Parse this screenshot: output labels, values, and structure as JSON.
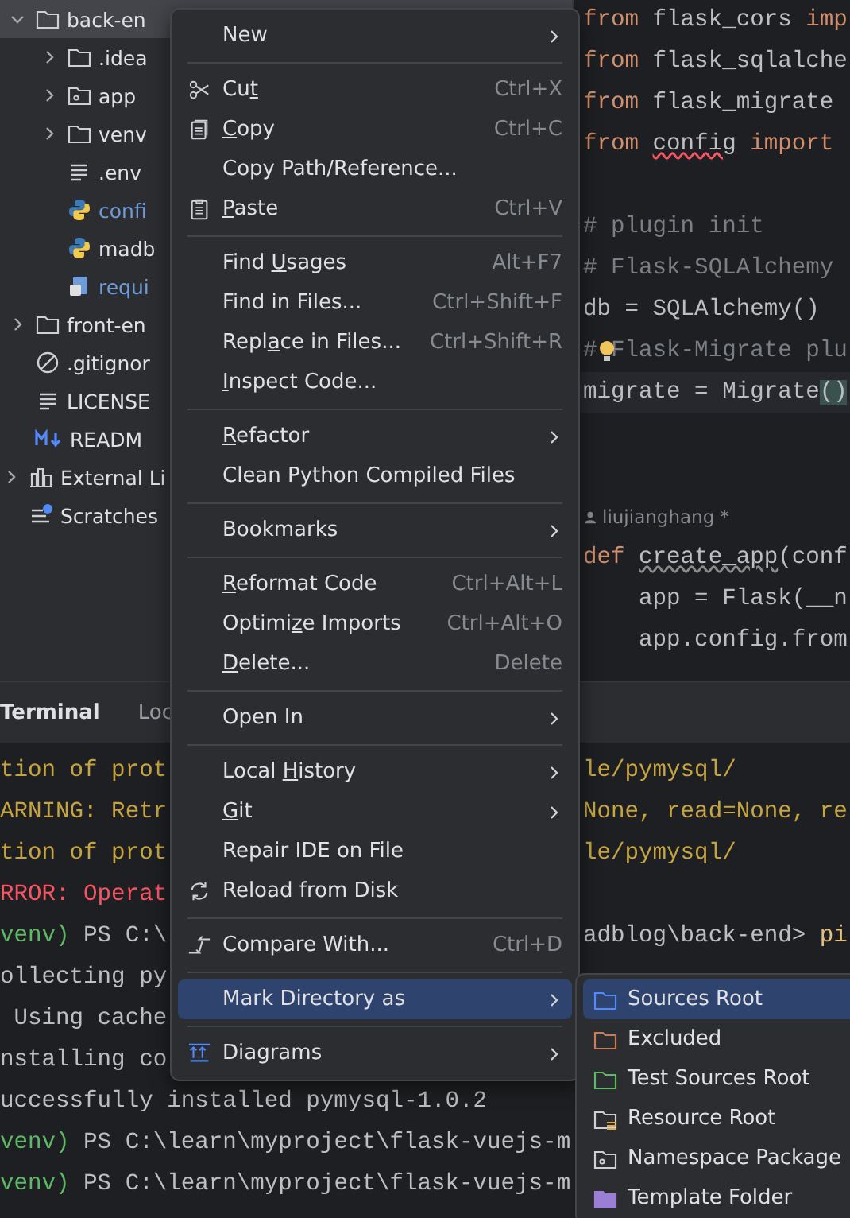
{
  "project_files": [
    {
      "label": "back-en",
      "kind": "folder",
      "expanded": true,
      "selected": true,
      "modified": false,
      "children": [
        {
          "label": ".idea",
          "kind": "folder",
          "expanded": false,
          "selected": false,
          "modified": false
        },
        {
          "label": "app",
          "kind": "package",
          "expanded": false,
          "selected": false,
          "modified": false
        },
        {
          "label": "venv",
          "kind": "folder",
          "expanded": false,
          "selected": false,
          "modified": false
        },
        {
          "label": ".env",
          "kind": "text",
          "selected": false,
          "modified": false
        },
        {
          "label": "confi",
          "kind": "python",
          "selected": false,
          "modified": true
        },
        {
          "label": "madb",
          "kind": "python",
          "selected": false,
          "modified": false
        },
        {
          "label": "requi",
          "kind": "requirements",
          "selected": false,
          "modified": true
        }
      ]
    },
    {
      "label": "front-en",
      "kind": "folder",
      "expanded": false,
      "selected": false,
      "modified": false
    },
    {
      "label": ".gitignor",
      "kind": "ignore",
      "selected": false,
      "modified": false
    },
    {
      "label": "LICENSE",
      "kind": "text",
      "selected": false,
      "modified": false
    },
    {
      "label": "READM",
      "kind": "markdown",
      "selected": false,
      "modified": false
    }
  ],
  "root_items": [
    {
      "label": "External Li",
      "kind": "library",
      "expanded": false,
      "selected": false,
      "modified": false
    },
    {
      "label": "Scratches",
      "kind": "scratches",
      "selected": false,
      "modified": false
    }
  ],
  "editor": {
    "lines": [
      {
        "kind": "code",
        "current": false,
        "bulb": false,
        "tokens": [
          {
            "text": "from",
            "kind": "kw"
          },
          {
            "text": " flask_cors ",
            "kind": "plain"
          },
          {
            "text": "imp",
            "kind": "kw"
          }
        ]
      },
      {
        "kind": "code",
        "current": false,
        "bulb": false,
        "tokens": [
          {
            "text": "from",
            "kind": "kw"
          },
          {
            "text": " flask_sqlalche",
            "kind": "plain"
          }
        ]
      },
      {
        "kind": "code",
        "current": false,
        "bulb": false,
        "tokens": [
          {
            "text": "from",
            "kind": "kw"
          },
          {
            "text": " flask_migrate",
            "kind": "plain"
          }
        ]
      },
      {
        "kind": "code",
        "current": false,
        "bulb": false,
        "tokens": [
          {
            "text": "from ",
            "kind": "kw"
          },
          {
            "text": "config",
            "kind": "error"
          },
          {
            "text": " import",
            "kind": "kw"
          }
        ]
      },
      {
        "kind": "blank"
      },
      {
        "kind": "code",
        "current": false,
        "bulb": false,
        "tokens": [
          {
            "text": "# plugin init",
            "kind": "comment"
          }
        ]
      },
      {
        "kind": "code",
        "current": false,
        "bulb": false,
        "tokens": [
          {
            "text": "# Flask-SQLAlchemy",
            "kind": "comment"
          }
        ]
      },
      {
        "kind": "code",
        "current": false,
        "bulb": false,
        "tokens": [
          {
            "text": "db = SQLAlchemy()",
            "kind": "plain"
          }
        ]
      },
      {
        "kind": "code",
        "current": false,
        "bulb": true,
        "tokens": [
          {
            "text": "# Flask-Migrate plu",
            "kind": "comment"
          }
        ]
      },
      {
        "kind": "code",
        "current": true,
        "bulb": false,
        "tokens": [
          {
            "text": "migrate = Migrate",
            "kind": "plain"
          },
          {
            "text": "()",
            "kind": "brace"
          }
        ]
      },
      {
        "kind": "blank"
      },
      {
        "kind": "blank"
      },
      {
        "kind": "author",
        "text": "liujianghang *"
      },
      {
        "kind": "code",
        "current": false,
        "bulb": false,
        "tokens": [
          {
            "text": "def ",
            "kind": "kw"
          },
          {
            "text": "create_app",
            "kind": "warn"
          },
          {
            "text": "(conf",
            "kind": "plain"
          }
        ]
      },
      {
        "kind": "code",
        "current": false,
        "bulb": false,
        "tokens": [
          {
            "text": "    app = Flask(__n",
            "kind": "plain"
          }
        ]
      },
      {
        "kind": "code",
        "current": false,
        "bulb": false,
        "tokens": [
          {
            "text": "    app.config.from",
            "kind": "plain"
          }
        ]
      }
    ]
  },
  "terminal": {
    "tabs": [
      {
        "label": "Terminal",
        "selected": true
      },
      {
        "label": "Loc",
        "selected": false
      }
    ],
    "lines": [
      {
        "left": [
          {
            "text": "tion of prot",
            "kind": "warn"
          }
        ],
        "right": [
          {
            "text": "le/pymysql/",
            "kind": "warn"
          }
        ]
      },
      {
        "left": [
          {
            "text": "ARNING: Retr",
            "kind": "warn"
          }
        ],
        "right": [
          {
            "text": "None, read=None, re",
            "kind": "warn"
          }
        ]
      },
      {
        "left": [
          {
            "text": "tion of prot",
            "kind": "warn"
          }
        ],
        "right": [
          {
            "text": "le/pymysql/",
            "kind": "warn"
          }
        ]
      },
      {
        "left": [
          {
            "text": "RROR: Operat",
            "kind": "error"
          }
        ]
      },
      {
        "left": [
          {
            "text": "venv)",
            "kind": "green"
          },
          {
            "text": " PS C:\\",
            "kind": "plain"
          }
        ],
        "right": [
          {
            "text": "adblog\\back-end> ",
            "kind": "plain"
          },
          {
            "text": "pi",
            "kind": "cmd"
          }
        ]
      },
      {
        "left": [
          {
            "text": "ollecting py",
            "kind": "plain"
          }
        ]
      },
      {
        "left": [
          {
            "text": " Using cache",
            "kind": "plain"
          }
        ]
      },
      {
        "left": [
          {
            "text": "nstalling co",
            "kind": "plain"
          }
        ]
      },
      {
        "left": [
          {
            "text": "uccessfully installed pymysql-1.0.2",
            "kind": "plain"
          }
        ]
      },
      {
        "left": [
          {
            "text": "venv)",
            "kind": "green"
          },
          {
            "text": " PS C:\\learn\\myproject\\flask-vuejs-m",
            "kind": "plain"
          }
        ]
      },
      {
        "left": [
          {
            "text": "venv)",
            "kind": "green"
          },
          {
            "text": " PS C:\\learn\\myproject\\flask-vuejs-m",
            "kind": "plain"
          }
        ]
      }
    ]
  },
  "context_menu": {
    "items": [
      {
        "kind": "text",
        "label": "New",
        "submenu": true,
        "selected": false
      },
      {
        "kind": "separator"
      },
      {
        "kind": "cut",
        "pre": "Cu",
        "key": "t",
        "shortcut": "Ctrl+X",
        "submenu": false,
        "selected": false
      },
      {
        "kind": "copy",
        "key": "C",
        "post": "opy",
        "shortcut": "Ctrl+C",
        "submenu": false,
        "selected": false
      },
      {
        "kind": "text",
        "label": "Copy Path/Reference...",
        "submenu": false,
        "selected": false
      },
      {
        "kind": "paste",
        "key": "P",
        "post": "aste",
        "shortcut": "Ctrl+V",
        "submenu": false,
        "selected": false
      },
      {
        "kind": "separator"
      },
      {
        "kind": "text",
        "pre": "Find ",
        "key": "U",
        "post": "sages",
        "shortcut": "Alt+F7",
        "submenu": false,
        "selected": false
      },
      {
        "kind": "text",
        "label": "Find in Files...",
        "shortcut": "Ctrl+Shift+F",
        "submenu": false,
        "selected": false
      },
      {
        "kind": "text",
        "pre": "Repl",
        "key": "a",
        "post": "ce in Files...",
        "shortcut": "Ctrl+Shift+R",
        "submenu": false,
        "selected": false
      },
      {
        "kind": "text",
        "key": "I",
        "post": "nspect Code...",
        "submenu": false,
        "selected": false
      },
      {
        "kind": "separator"
      },
      {
        "kind": "text",
        "key": "R",
        "post": "efactor",
        "submenu": true,
        "selected": false
      },
      {
        "kind": "text",
        "label": "Clean Python Compiled Files",
        "submenu": false,
        "selected": false
      },
      {
        "kind": "separator"
      },
      {
        "kind": "text",
        "label": "Bookmarks",
        "submenu": true,
        "selected": false
      },
      {
        "kind": "separator"
      },
      {
        "kind": "text",
        "key": "R",
        "post": "eformat Code",
        "shortcut": "Ctrl+Alt+L",
        "submenu": false,
        "selected": false
      },
      {
        "kind": "text",
        "pre": "Optimi",
        "key": "z",
        "post": "e Imports",
        "shortcut": "Ctrl+Alt+O",
        "submenu": false,
        "selected": false
      },
      {
        "kind": "text",
        "key": "D",
        "post": "elete...",
        "shortcut": "Delete",
        "submenu": false,
        "selected": false
      },
      {
        "kind": "separator"
      },
      {
        "kind": "text",
        "label": "Open In",
        "submenu": true,
        "selected": false
      },
      {
        "kind": "separator"
      },
      {
        "kind": "text",
        "pre": "Local ",
        "key": "H",
        "post": "istory",
        "submenu": true,
        "selected": false
      },
      {
        "kind": "text",
        "key": "G",
        "post": "it",
        "submenu": true,
        "selected": false
      },
      {
        "kind": "text",
        "label": "Repair IDE on File",
        "submenu": false,
        "selected": false
      },
      {
        "kind": "reload",
        "label": "Reload from Disk",
        "submenu": false,
        "selected": false
      },
      {
        "kind": "separator"
      },
      {
        "kind": "compare",
        "label": "Compare With...",
        "shortcut": "Ctrl+D",
        "submenu": false,
        "selected": false
      },
      {
        "kind": "separator"
      },
      {
        "kind": "text",
        "label": "Mark Directory as",
        "submenu": true,
        "selected": true
      },
      {
        "kind": "separator"
      },
      {
        "kind": "diagrams",
        "label": "Diagrams",
        "submenu": true,
        "selected": false
      }
    ]
  },
  "submenu": {
    "items": [
      {
        "label": "Sources Root",
        "kind": "folder",
        "color": "#548af7",
        "selected": true
      },
      {
        "label": "Excluded",
        "kind": "folder",
        "color": "#c77d55",
        "selected": false
      },
      {
        "label": "Test Sources Root",
        "kind": "folder",
        "color": "#5fb865",
        "selected": false
      },
      {
        "label": "Resource Root",
        "kind": "resource",
        "color": "#ced0d6",
        "selected": false
      },
      {
        "label": "Namespace Package",
        "kind": "package",
        "color": "#ced0d6",
        "selected": false
      },
      {
        "label": "Template Folder",
        "kind": "filled-folder",
        "color": "#9b7fd4",
        "selected": false
      }
    ]
  }
}
